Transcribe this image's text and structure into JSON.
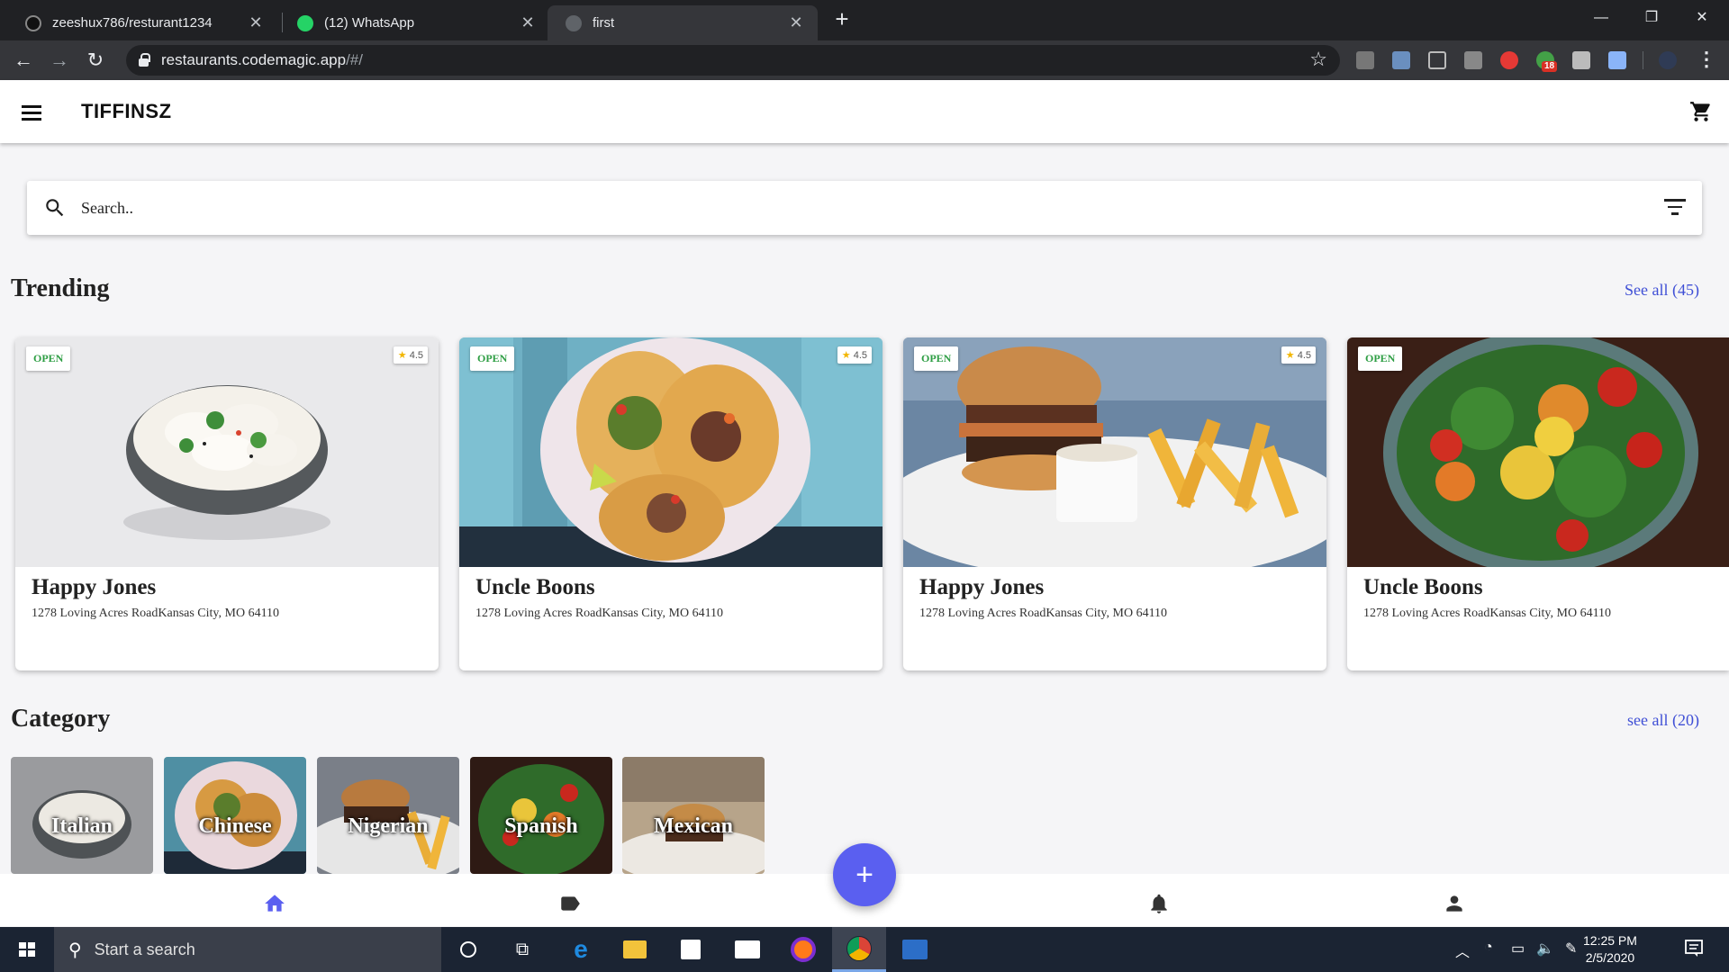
{
  "browser": {
    "tabs": [
      {
        "title": "zeeshux786/resturant1234",
        "icon": "github-icon"
      },
      {
        "title": "(12) WhatsApp",
        "icon": "whatsapp-icon"
      },
      {
        "title": "first",
        "icon": "globe-icon",
        "active": true
      }
    ],
    "new_tab": "+",
    "url_host": "restaurants.codemagic.app",
    "url_path": "/#/",
    "extension_badge": "18"
  },
  "app": {
    "title": "TIFFINSZ",
    "search_placeholder": "Search..",
    "trending": {
      "title": "Trending",
      "see_all": "See all (45)",
      "cards": [
        {
          "status": "OPEN",
          "rating": "4.5",
          "name": "Happy Jones",
          "address": "1278 Loving Acres RoadKansas City, MO 64110",
          "image": "dumplings"
        },
        {
          "status": "OPEN",
          "rating": "4.5",
          "name": "Uncle Boons",
          "address": "1278 Loving Acres RoadKansas City, MO 64110",
          "image": "tacos"
        },
        {
          "status": "OPEN",
          "rating": "4.5",
          "name": "Happy Jones",
          "address": "1278 Loving Acres RoadKansas City, MO 64110",
          "image": "burger"
        },
        {
          "status": "OPEN",
          "rating": "",
          "name": "Uncle Boons",
          "address": "1278 Loving Acres RoadKansas City, MO 64110",
          "image": "salad"
        }
      ]
    },
    "category": {
      "title": "Category",
      "see_all": "see all (20)",
      "items": [
        "Italian",
        "Chinese",
        "Nigerian",
        "Spanish",
        "Mexican"
      ]
    },
    "bottom_nav": [
      "home-icon",
      "tag-icon",
      "bell-icon",
      "person-icon"
    ],
    "fab": "+",
    "colors": {
      "accent": "#5a5ff0",
      "link": "#3f4fd6",
      "open": "#2e9e44"
    }
  },
  "taskbar": {
    "search_text": "Start a search",
    "time": "12:25 PM",
    "date": "2/5/2020"
  }
}
